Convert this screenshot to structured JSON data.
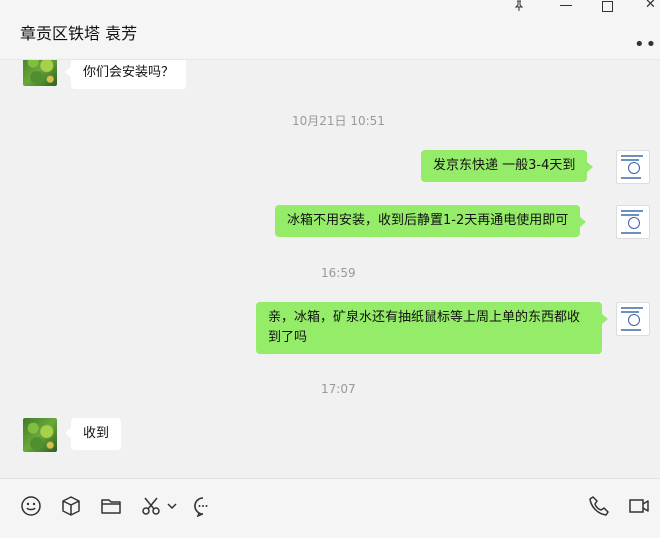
{
  "window": {
    "title": "章贡区铁塔 袁芳",
    "controls": [
      "pin-icon",
      "minimize-icon",
      "maximize-icon",
      "close-icon"
    ],
    "more_icon": "more-icon"
  },
  "messages": [
    {
      "type": "text",
      "side": "in",
      "text": "你们会安装吗？"
    },
    {
      "type": "time",
      "text": "10月21日 10:51"
    },
    {
      "type": "text",
      "side": "out",
      "text": "发京东快递  一般3-4天到"
    },
    {
      "type": "text",
      "side": "out",
      "text": "冰箱不用安装，收到后静置1-2天再通电使用即可"
    },
    {
      "type": "time",
      "text": "16:59"
    },
    {
      "type": "text",
      "side": "out",
      "text": "亲，冰箱，矿泉水还有抽纸鼠标等上周上单的东西都收到了吗"
    },
    {
      "type": "time",
      "text": "17:07"
    },
    {
      "type": "text",
      "side": "in",
      "text": "收到"
    }
  ],
  "toolbar": {
    "left_icons": [
      "emoji-icon",
      "sticker-box-icon",
      "folder-icon",
      "scissors-icon",
      "chevron-down-icon",
      "chat-history-icon"
    ],
    "right_icons": [
      "phone-icon",
      "video-call-icon"
    ]
  },
  "colors": {
    "outgoing_bubble": "#95ec69",
    "incoming_bubble": "#ffffff",
    "background": "#f1f1f1"
  }
}
